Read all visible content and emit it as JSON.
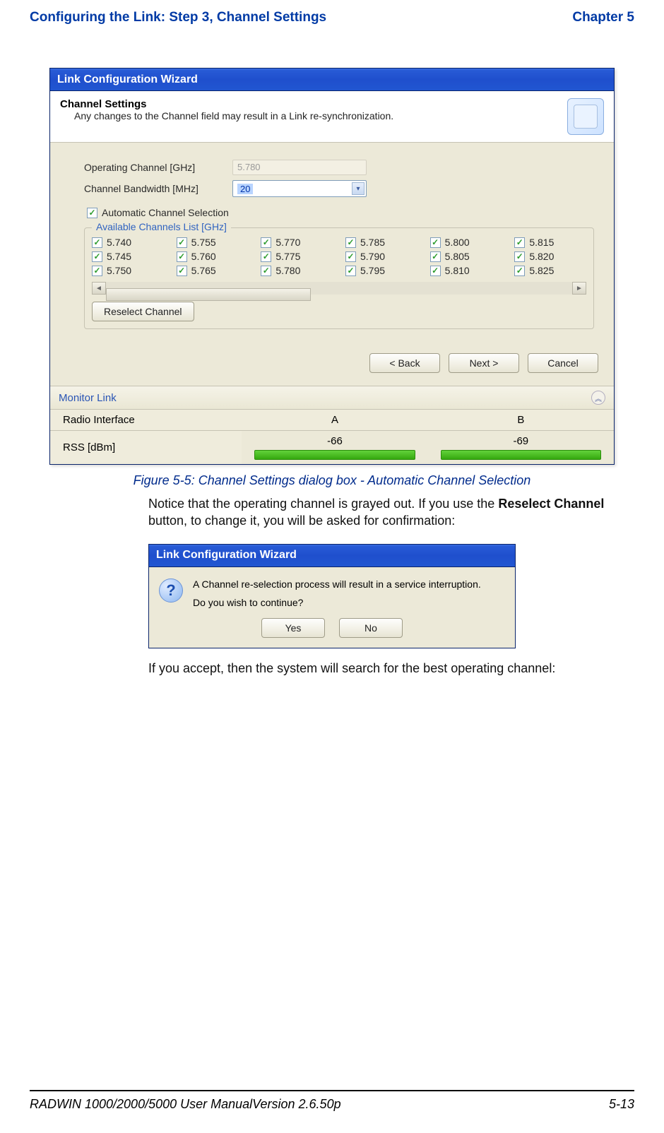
{
  "header": {
    "left": "Configuring the Link: Step 3, Channel Settings",
    "right": "Chapter 5"
  },
  "window": {
    "title": "Link Configuration Wizard",
    "panel": {
      "title": "Channel Settings",
      "subtitle": "Any changes to the Channel field may result in a Link re-synchronization."
    },
    "form": {
      "operating_label": "Operating Channel [GHz]",
      "operating_value": "5.780",
      "bandwidth_label": "Channel Bandwidth [MHz]",
      "bandwidth_value": "20",
      "auto_label": "Automatic Channel Selection",
      "auto_checked": true
    },
    "channels": {
      "legend": "Available Channels List [GHz]",
      "items": [
        {
          "label": "5.740",
          "checked": true
        },
        {
          "label": "5.755",
          "checked": true
        },
        {
          "label": "5.770",
          "checked": true
        },
        {
          "label": "5.785",
          "checked": true
        },
        {
          "label": "5.800",
          "checked": true
        },
        {
          "label": "5.815",
          "checked": true
        },
        {
          "label": "5.745",
          "checked": true
        },
        {
          "label": "5.760",
          "checked": true
        },
        {
          "label": "5.775",
          "checked": true
        },
        {
          "label": "5.790",
          "checked": true
        },
        {
          "label": "5.805",
          "checked": true
        },
        {
          "label": "5.820",
          "checked": true
        },
        {
          "label": "5.750",
          "checked": true
        },
        {
          "label": "5.765",
          "checked": true
        },
        {
          "label": "5.780",
          "checked": true
        },
        {
          "label": "5.795",
          "checked": true
        },
        {
          "label": "5.810",
          "checked": true
        },
        {
          "label": "5.825",
          "checked": true
        }
      ],
      "reselect_label": "Reselect Channel"
    },
    "nav": {
      "back": "< Back",
      "next": "Next >",
      "cancel": "Cancel"
    },
    "monitor": {
      "title": "Monitor Link",
      "row1_label": "Radio Interface",
      "colA": "A",
      "colB": "B",
      "rss_label": "RSS [dBm]",
      "rss_a": "-66",
      "rss_b": "-69"
    }
  },
  "caption": "Figure 5-5: Channel Settings dialog box - Automatic Channel Selection",
  "para1_a": "Notice that the operating channel is grayed out. If you use the ",
  "para1_b": "Reselect Channel",
  "para1_c": " button, to change it, you will be asked for confirmation:",
  "dialog": {
    "title": "Link Configuration Wizard",
    "line1": "A Channel re-selection process will result in a service interruption.",
    "line2": "Do you wish to continue?",
    "yes": "Yes",
    "no": "No"
  },
  "para2": "If you accept, then the system will search for the best operating channel:",
  "footer": {
    "left": "RADWIN 1000/2000/5000 User ManualVersion  2.6.50p",
    "right": "5-13"
  }
}
